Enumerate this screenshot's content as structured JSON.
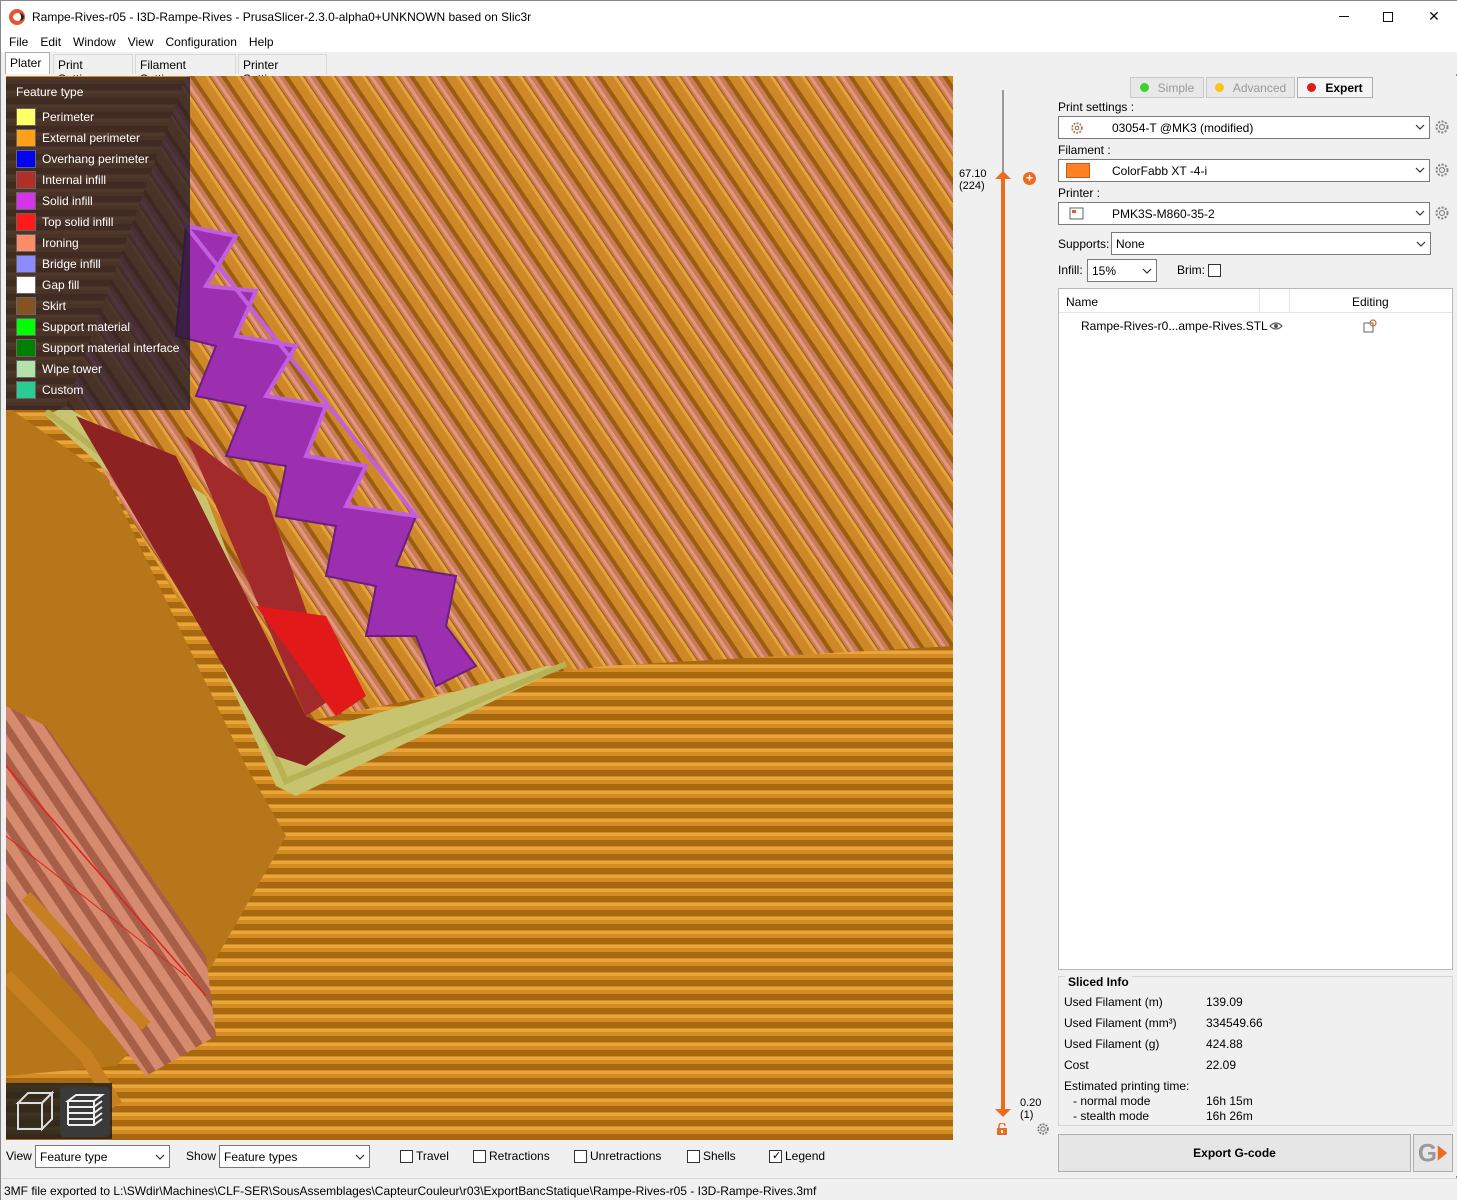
{
  "window": {
    "title": "Rampe-Rives-r05 - I3D-Rampe-Rives - PrusaSlicer-2.3.0-alpha0+UNKNOWN based on Slic3r"
  },
  "menu": [
    "File",
    "Edit",
    "Window",
    "View",
    "Configuration",
    "Help"
  ],
  "tabs": [
    "Plater",
    "Print Settings",
    "Filament Settings",
    "Printer Settings"
  ],
  "legend": {
    "title": "Feature type",
    "items": [
      {
        "label": "Perimeter",
        "color": "#ffff66"
      },
      {
        "label": "External perimeter",
        "color": "#ff9f1a"
      },
      {
        "label": "Overhang perimeter",
        "color": "#0000ff"
      },
      {
        "label": "Internal infill",
        "color": "#b03029"
      },
      {
        "label": "Solid infill",
        "color": "#d633eb"
      },
      {
        "label": "Top solid infill",
        "color": "#ff1a1a"
      },
      {
        "label": "Ironing",
        "color": "#ff8c69"
      },
      {
        "label": "Bridge infill",
        "color": "#8c8cff"
      },
      {
        "label": "Gap fill",
        "color": "#ffffff"
      },
      {
        "label": "Skirt",
        "color": "#845321"
      },
      {
        "label": "Support material",
        "color": "#00ff00"
      },
      {
        "label": "Support material interface",
        "color": "#008000"
      },
      {
        "label": "Wipe tower",
        "color": "#b3e3ab"
      },
      {
        "label": "Custom",
        "color": "#28cc94"
      }
    ]
  },
  "layer_slider": {
    "top_value": "67.10",
    "top_layer": "(224)",
    "bottom_value": "0.20",
    "bottom_layer": "(1)"
  },
  "sidebar": {
    "modes": [
      {
        "label": "Simple",
        "color": "#3ed130",
        "active": false
      },
      {
        "label": "Advanced",
        "color": "#f8c51a",
        "active": false
      },
      {
        "label": "Expert",
        "color": "#e31a1c",
        "active": true
      }
    ],
    "print_settings_label": "Print settings :",
    "print_settings_value": "03054-T @MK3 (modified)",
    "filament_label": "Filament :",
    "filament_value": "ColorFabb XT -4-i",
    "filament_color": "#ff8025",
    "printer_label": "Printer :",
    "printer_value": "PMK3S-M860-35-2",
    "supports_label": "Supports:",
    "supports_value": "None",
    "infill_label": "Infill:",
    "infill_value": "15%",
    "brim_label": "Brim:"
  },
  "object_list": {
    "col_name": "Name",
    "col_editing": "Editing",
    "object_name": "Rampe-Rives-r0...ampe-Rives.STL"
  },
  "sliced_info": {
    "title": "Sliced Info",
    "used_filament_m_label": "Used Filament (m)",
    "used_filament_m": "139.09",
    "used_filament_mm3_label": "Used Filament (mm³)",
    "used_filament_mm3": "334549.66",
    "used_filament_g_label": "Used Filament (g)",
    "used_filament_g": "424.88",
    "cost_label": "Cost",
    "cost": "22.09",
    "time_label": "Estimated printing time:",
    "normal_label": "- normal mode",
    "normal_time": "16h 15m",
    "stealth_label": "- stealth mode",
    "stealth_time": "16h 26m"
  },
  "export_label": "Export G-code",
  "bottombar": {
    "view_label": "View",
    "view_value": "Feature type",
    "show_label": "Show",
    "show_value": "Feature types",
    "checks": [
      {
        "label": "Travel",
        "checked": false
      },
      {
        "label": "Retractions",
        "checked": false
      },
      {
        "label": "Unretractions",
        "checked": false
      },
      {
        "label": "Shells",
        "checked": false
      },
      {
        "label": "Legend",
        "checked": true
      }
    ]
  },
  "status": "3MF file exported to L:\\SWdir\\Machines\\CLF-SER\\SousAssemblages\\CapteurCouleur\\r03\\ExportBancStatique\\Rampe-Rives-r05 - I3D-Rampe-Rives.3mf",
  "scene_colors": {
    "external": "#c98320",
    "external_light": "#e29d33",
    "ironing": "#cf7a5a",
    "perimeter": "#c6c36c",
    "solid": "#9b2fb0",
    "internal": "#8c2222",
    "top": "#e01818"
  }
}
